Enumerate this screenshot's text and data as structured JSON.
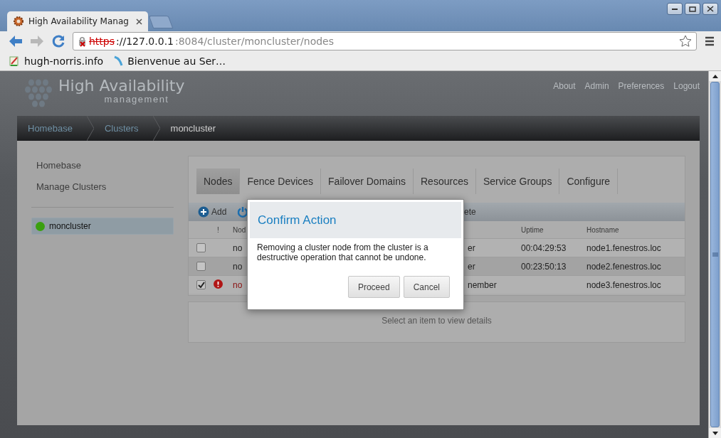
{
  "browser": {
    "tab_title": "High Availability Manag",
    "url": {
      "scheme": "https",
      "host": "://127.0.0.1",
      "path": ":8084/cluster/moncluster/nodes"
    },
    "bookmarks": [
      {
        "kind": "notes",
        "label": "hugh-norris.info"
      },
      {
        "kind": "wave",
        "label": "Bienvenue au Ser…"
      }
    ]
  },
  "header": {
    "logo_title": "High Availability",
    "logo_subtitle": "management",
    "links": [
      "About",
      "Admin",
      "Preferences",
      "Logout"
    ]
  },
  "breadcrumb": [
    "Homebase",
    "Clusters",
    "moncluster"
  ],
  "sidebar": {
    "items": [
      "Homebase",
      "Manage Clusters"
    ],
    "clusters": [
      {
        "name": "moncluster",
        "color": "#3aa010",
        "selected": true
      }
    ]
  },
  "tabs": [
    {
      "label": "Nodes",
      "selected": true
    },
    {
      "label": "Fence Devices",
      "selected": false
    },
    {
      "label": "Failover Domains",
      "selected": false
    },
    {
      "label": "Resources",
      "selected": false
    },
    {
      "label": "Service Groups",
      "selected": false
    },
    {
      "label": "Configure",
      "selected": false
    }
  ],
  "toolbar": {
    "add": "Add",
    "column_3": "ete"
  },
  "table": {
    "columns": {
      "alert": "!",
      "node": "Nod",
      "uptime": "Uptime",
      "hostname": "Hostname"
    },
    "rows": [
      {
        "checked": false,
        "alert": false,
        "node": "no",
        "status": "er",
        "uptime": "00:04:29:53",
        "hostname": "node1.fenestros.loc"
      },
      {
        "checked": false,
        "alert": false,
        "node": "no",
        "status": "er",
        "uptime": "00:23:50:13",
        "hostname": "node2.fenestros.loc"
      },
      {
        "checked": true,
        "alert": true,
        "node": "no",
        "status": "nember",
        "hostname": "node3.fenestros.loc"
      }
    ]
  },
  "details": "Select an item to view details",
  "dialog": {
    "title": "Confirm Action",
    "message": "Removing a cluster node from the cluster is a destructive operation that cannot be undone.",
    "buttons": [
      "Proceed",
      "Cancel"
    ]
  }
}
